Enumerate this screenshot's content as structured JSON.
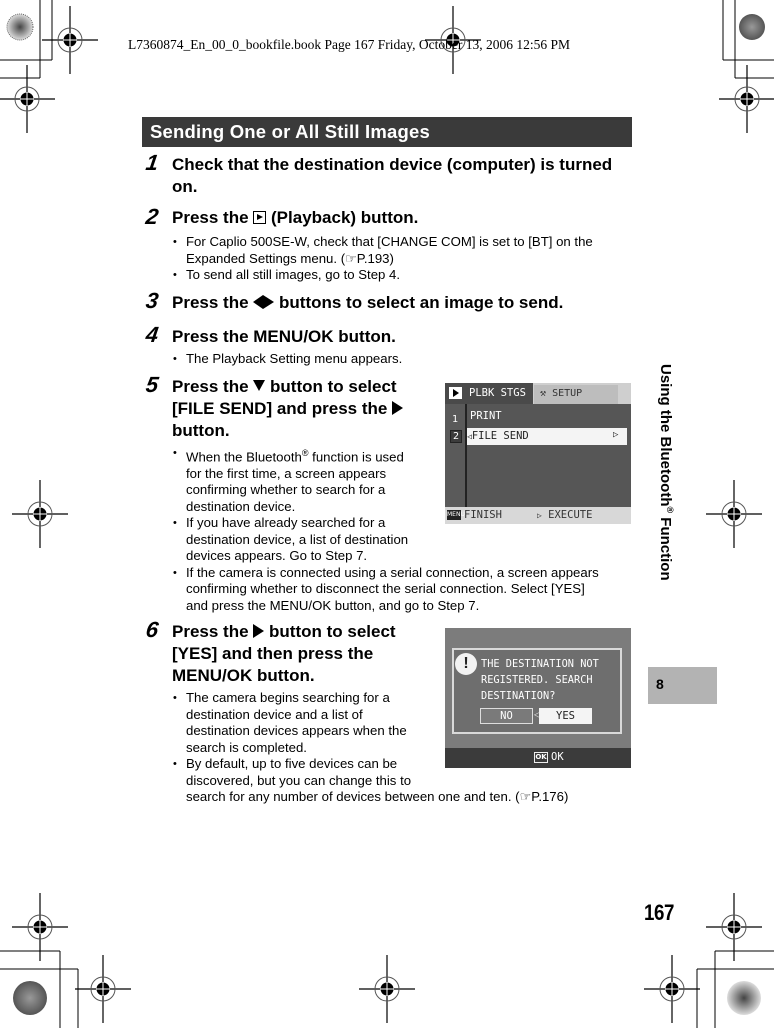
{
  "print_header": "L7360874_En_00_0_bookfile.book  Page 167  Friday, October 13, 2006  12:56 PM",
  "section_title": "Sending One or All Still Images",
  "steps": [
    {
      "number": "1",
      "title_lines": [
        "Check that the destination device (computer) is turned",
        "on."
      ]
    },
    {
      "number": "2",
      "title_pre": "Press the",
      "title_icon": "playback-icon",
      "title_post": "(Playback) button.",
      "bullets": [
        {
          "line1": "For Caplio 500SE-W, check that [CHANGE COM] is set to [BT] on the",
          "line2": "Expanded Settings menu. (",
          "ref": "P.193",
          "tail": ")"
        },
        {
          "line1": "To send all still images, go to Step 4."
        }
      ]
    },
    {
      "number": "3",
      "title_pre": "Press the",
      "title_icon": "left-right-arrows-icon",
      "title_post": "buttons to select an image to send."
    },
    {
      "number": "4",
      "title": "Press the MENU/OK button.",
      "bullets": [
        {
          "line1": "The Playback Setting menu appears."
        }
      ]
    },
    {
      "number": "5",
      "title_line1_pre": "Press the",
      "title_line1_post": "button to select",
      "title_line2_pre": "[FILE SEND] and press the",
      "title_line3": "button.",
      "bullets": [
        {
          "lines": [
            "When the Bluetooth",
            "function is used",
            "for the first time, a screen appears",
            "confirming whether to search for a",
            "destination device."
          ],
          "sup": "®"
        },
        {
          "lines": [
            "If you have already searched for a",
            "destination device, a list of destination",
            "devices appears. Go to Step 7."
          ]
        },
        {
          "lines": [
            "If the camera is connected using a serial connection, a screen appears",
            "confirming whether to disconnect the serial connection. Select [YES]",
            "and press the MENU/OK button, and go to Step 7."
          ]
        }
      ]
    },
    {
      "number": "6",
      "title_line1_pre": "Press the",
      "title_line1_post": "button to select",
      "title_line2": "[YES] and then press the",
      "title_line3": "MENU/OK button.",
      "bullets": [
        {
          "lines": [
            "The camera begins searching for a",
            "destination device and a list of",
            "destination devices appears when the",
            "search is completed."
          ]
        },
        {
          "lines": [
            "By default, up to five devices can be",
            "discovered, but you can change this to",
            "search for any number of devices between one and ten. ("
          ],
          "ref": "P.176",
          "tail": ")"
        }
      ]
    }
  ],
  "screen1": {
    "tab_active": "PLBK STGS",
    "tab_inactive": "SETUP",
    "items": [
      {
        "num": "1",
        "label": "PRINT"
      },
      {
        "num": "2",
        "label": "FILE SEND",
        "selected": true
      }
    ],
    "footer_menu_chip": "MENU",
    "footer_left": "FINISH",
    "footer_right": "EXECUTE"
  },
  "screen2": {
    "message": "THE DESTINATION NOT\nREGISTERED. SEARCH\nDESTINATION?",
    "no_label": "NO",
    "yes_label": "YES",
    "selected": "YES",
    "ok_chip": "OK",
    "footer_label": "OK"
  },
  "side_tab": {
    "label": "Using the Bluetooth",
    "sup": "®",
    "label_tail": " Function",
    "chapter": "8"
  },
  "page_number": "167"
}
